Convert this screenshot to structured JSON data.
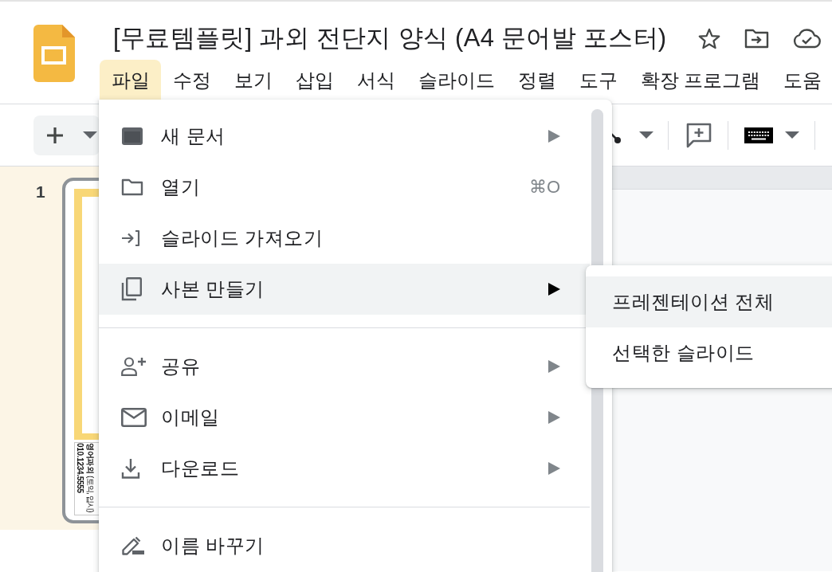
{
  "title": "[무료템플릿] 과외 전단지 양식 (A4 문어발 포스터)",
  "menu_bar": [
    {
      "label": "파일",
      "selected": true
    },
    {
      "label": "수정",
      "selected": false
    },
    {
      "label": "보기",
      "selected": false
    },
    {
      "label": "삽입",
      "selected": false
    },
    {
      "label": "서식",
      "selected": false
    },
    {
      "label": "슬라이드",
      "selected": false
    },
    {
      "label": "정렬",
      "selected": false
    },
    {
      "label": "도구",
      "selected": false
    },
    {
      "label": "확장 프로그램",
      "selected": false
    },
    {
      "label": "도움",
      "selected": false
    }
  ],
  "file_menu": {
    "sections": [
      {
        "items": [
          {
            "label": "새 문서",
            "submenu": true,
            "highlighted": false
          },
          {
            "label": "열기",
            "shortcut": "⌘O",
            "submenu": false,
            "highlighted": false
          },
          {
            "label": "슬라이드 가져오기",
            "submenu": false,
            "highlighted": false
          },
          {
            "label": "사본 만들기",
            "submenu": true,
            "highlighted": true
          }
        ]
      },
      {
        "items": [
          {
            "label": "공유",
            "submenu": true,
            "highlighted": false
          },
          {
            "label": "이메일",
            "submenu": true,
            "highlighted": false
          },
          {
            "label": "다운로드",
            "submenu": true,
            "highlighted": false
          }
        ]
      },
      {
        "items": [
          {
            "label": "이름 바꾸기",
            "submenu": false,
            "highlighted": false
          }
        ]
      }
    ]
  },
  "copy_submenu": {
    "items": [
      {
        "label": "프레젠테이션 전체",
        "highlighted": true
      },
      {
        "label": "선택한 슬라이드",
        "highlighted": false
      }
    ]
  },
  "filmstrip": {
    "slides": [
      {
        "number": "1",
        "selected": true,
        "title": "영어과외",
        "subtitle": "(토익, 입시)",
        "phone": "010.1234.5555"
      }
    ]
  }
}
